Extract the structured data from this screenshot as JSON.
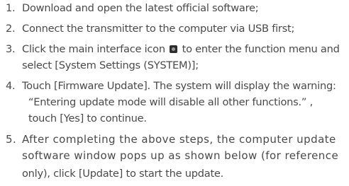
{
  "steps": [
    {
      "num": "1.",
      "lines": [
        "Download and open the latest official software;"
      ]
    },
    {
      "num": "2.",
      "lines": [
        "Connect the transmitter to the computer via USB first;"
      ]
    },
    {
      "num": "3.",
      "line1_before_icon": "Click the main interface icon",
      "line1_after_icon": "to enter the function menu and",
      "icon": "settings-icon",
      "lines": [
        "select [System Settings (SYSTEM)];"
      ]
    },
    {
      "num": "4.",
      "lines": [
        "Touch [Firmware Update]. The system will display the warning:",
        "“Entering update mode will disable all other functions.” ,",
        "touch [Yes] to continue."
      ]
    },
    {
      "num": "5.",
      "lines": [
        "After completing the above steps, the computer update",
        "software window pops up as shown below (for reference",
        "only), click [Update] to start the update."
      ]
    }
  ]
}
